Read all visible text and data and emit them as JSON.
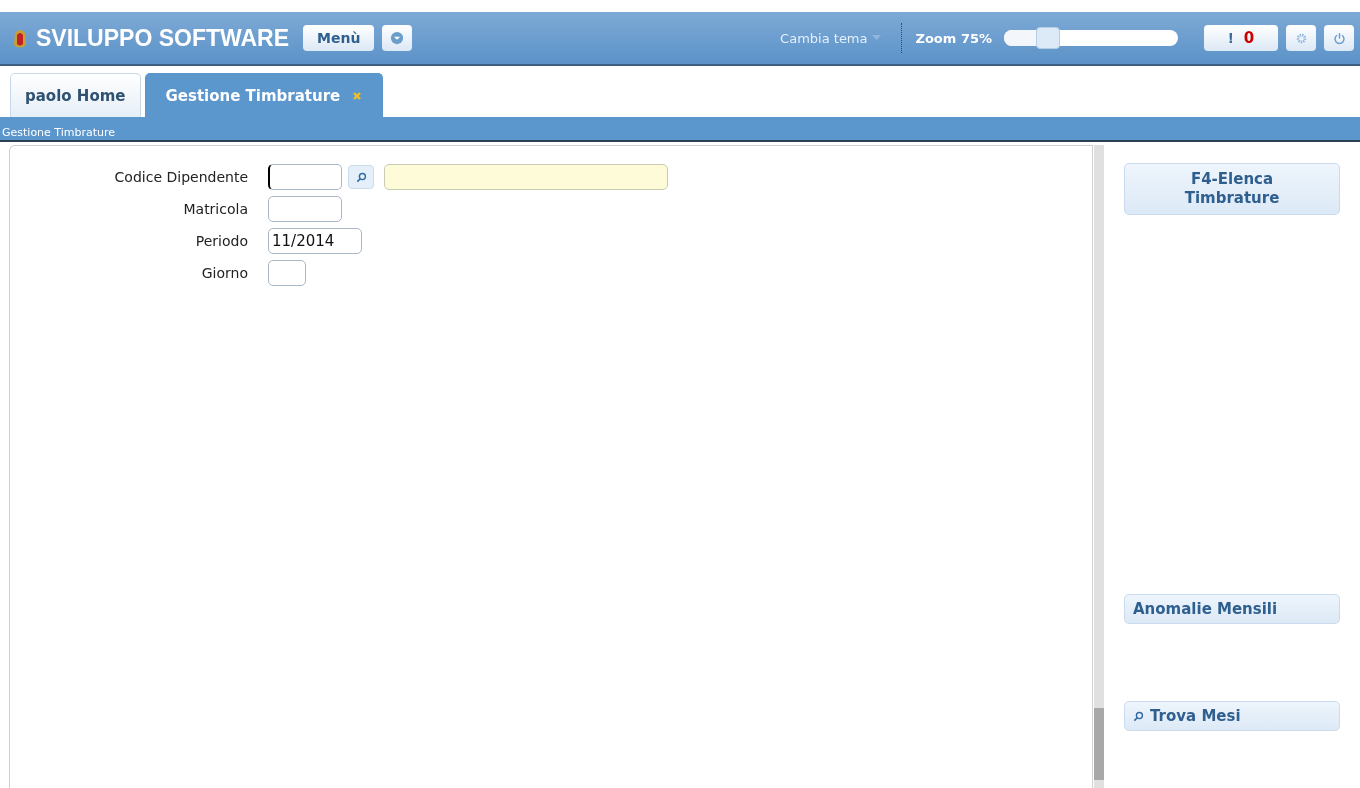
{
  "header": {
    "title": "SVILUPPO SOFTWARE",
    "menu_button": "Menù",
    "theme": "Cambia tema",
    "zoom": {
      "label": "Zoom 75%",
      "level": 0.25
    },
    "alerts": {
      "icon": "!",
      "count": "0"
    }
  },
  "tabs": [
    {
      "label": "paolo Home",
      "selected": false,
      "closable": false
    },
    {
      "label": "Gestione Timbrature",
      "selected": true,
      "closable": true
    }
  ],
  "breadcrumb": "Gestione Timbrature",
  "form": [
    {
      "label": "Codice Dipendente",
      "kind": "lookup",
      "focused": true
    },
    {
      "label": "Matricola",
      "kind": "text",
      "focused": false
    },
    {
      "label": "Periodo",
      "kind": "period",
      "value": "11/2014",
      "focused": false
    },
    {
      "label": "Giorno",
      "kind": "day",
      "focused": false
    }
  ],
  "actions": [
    {
      "label": "F4-Elenca Timbrature",
      "kind": "plain"
    },
    {
      "label": "Anomalie Mensili",
      "kind": "plain"
    },
    {
      "label": "Trova Mesi",
      "kind": "search"
    }
  ]
}
